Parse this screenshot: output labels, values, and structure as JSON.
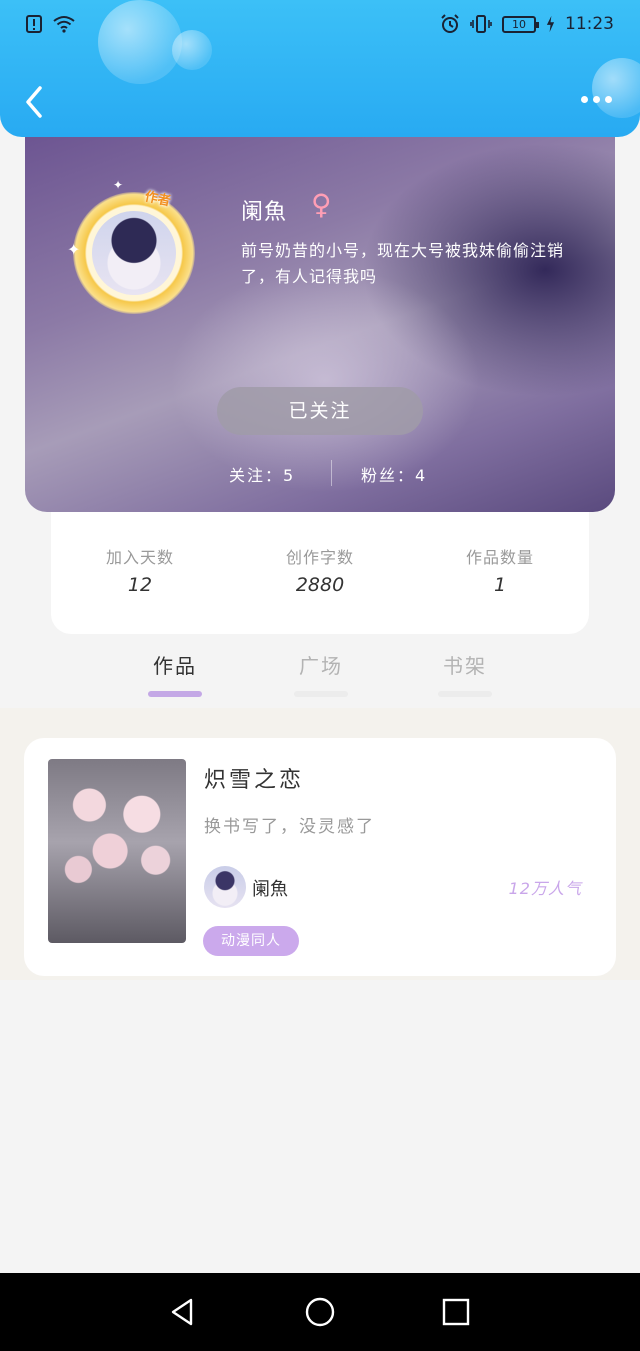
{
  "status_bar": {
    "time": "11:23",
    "battery_level": "10",
    "icons": [
      "alert-icon",
      "wifi-icon",
      "alarm-icon",
      "vibrate-icon",
      "battery-icon",
      "charging-icon"
    ]
  },
  "header": {
    "back_icon": "chevron-left-icon",
    "more_icon": "more-dots-icon"
  },
  "profile": {
    "author_badge": "作者",
    "name": "阑魚",
    "gender_symbol": "♀",
    "bio": "前号奶昔的小号，现在大号被我妹偷偷注销了，有人记得我吗",
    "follow_button_label": "已关注",
    "following": "关注：5",
    "fans": "粉丝：4"
  },
  "counters": [
    {
      "label": "加入天数",
      "value": "12"
    },
    {
      "label": "创作字数",
      "value": "2880"
    },
    {
      "label": "作品数量",
      "value": "1"
    }
  ],
  "tabs": [
    {
      "label": "作品",
      "active": true
    },
    {
      "label": "广场",
      "active": false
    },
    {
      "label": "书架",
      "active": false
    }
  ],
  "works": [
    {
      "title": "炽雪之恋",
      "description": "换书写了，没灵感了",
      "author": "阑魚",
      "popularity": "12万人气",
      "tag": "动漫同人"
    }
  ],
  "nav_bar": {
    "icons": [
      "nav-back-icon",
      "nav-home-icon",
      "nav-recents-icon"
    ]
  },
  "colors": {
    "header": "#2fb4f5",
    "accent_purple": "#c4a8e6",
    "tag_purple": "#cba9ec"
  }
}
